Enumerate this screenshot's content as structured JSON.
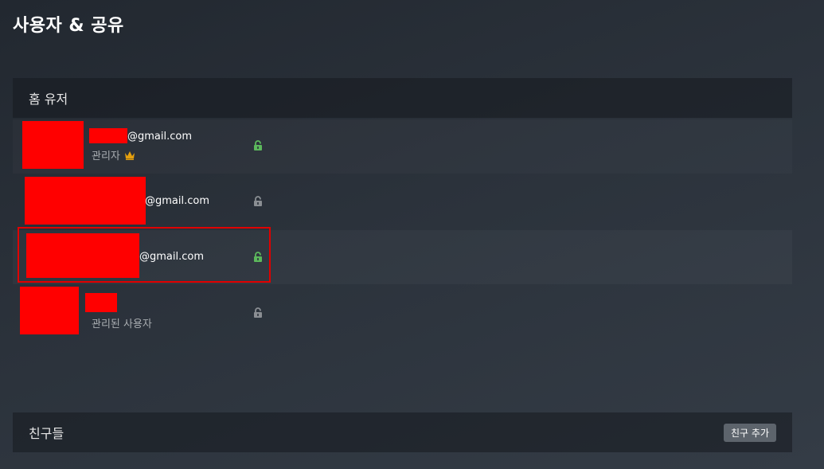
{
  "page": {
    "title": "사용자 & 공유"
  },
  "home_users": {
    "header": "홈 유저",
    "rows": [
      {
        "email_suffix": "@gmail.com",
        "role": "관리자",
        "role_icon": "crown-icon",
        "lock_state": "unlocked",
        "lock_color": "#5cb85c"
      },
      {
        "email_suffix": "@gmail.com",
        "role": "",
        "lock_state": "unlocked",
        "lock_color": "#8a8e93"
      },
      {
        "email_suffix": "@gmail.com",
        "role": "",
        "lock_state": "unlocked",
        "lock_color": "#5cb85c",
        "highlighted": true
      },
      {
        "email_suffix": "",
        "role": "관리된 사용자",
        "lock_state": "unlocked",
        "lock_color": "#8a8e93"
      }
    ]
  },
  "friends": {
    "header": "친구들",
    "add_button": "친구 추가"
  },
  "colors": {
    "redaction": "#ff0000",
    "highlight": "#e00000",
    "crown": "#e5a00d",
    "lock_green": "#5cb85c",
    "lock_gray": "#8a8e93"
  }
}
